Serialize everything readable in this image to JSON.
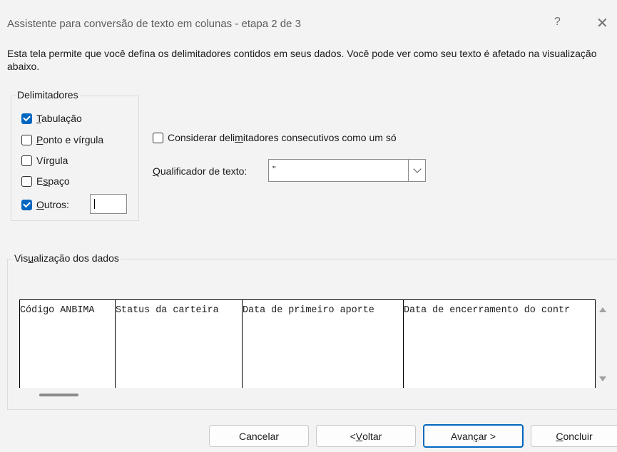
{
  "window": {
    "title": "Assistente para conversão de texto em colunas - etapa 2 de 3",
    "help": "?",
    "close": "✕"
  },
  "description": "Esta tela permite que você defina os delimitadores contidos em seus dados. Você pode ver como seu texto é afetado na visualização abaixo.",
  "delimiters": {
    "group_label": "Delimitadores",
    "tab": {
      "pre": "",
      "key": "T",
      "post": "abulação",
      "checked": true
    },
    "semicolon": {
      "pre": "",
      "key": "P",
      "post": "onto e vírgula",
      "checked": false
    },
    "comma": {
      "pre": "Vír",
      "key": "g",
      "post": "ula",
      "checked": false
    },
    "space": {
      "pre": "E",
      "key": "s",
      "post": "paço",
      "checked": false
    },
    "other": {
      "pre": "",
      "key": "O",
      "post": "utros:",
      "checked": true,
      "value": "|"
    }
  },
  "consecutive": {
    "pre": "Considerar deli",
    "key": "m",
    "post": "itadores consecutivos como um só",
    "checked": false
  },
  "qualifier": {
    "key": "Q",
    "post": "ualificador de texto:",
    "value": "\""
  },
  "preview": {
    "label_pre": "Vis",
    "label_key": "u",
    "label_post": "alização dos dados",
    "columns": [
      "Código ANBIMA",
      "Status da carteira",
      "Data de primeiro aporte",
      "Data de encerramento do contr"
    ]
  },
  "buttons": {
    "cancel": "Cancelar",
    "back_pre": "< ",
    "back_key": "V",
    "back_post": "oltar",
    "next_pre": "Avan",
    "next_key": "ç",
    "next_post": "ar >",
    "finish_key": "C",
    "finish_post": "oncluir"
  }
}
